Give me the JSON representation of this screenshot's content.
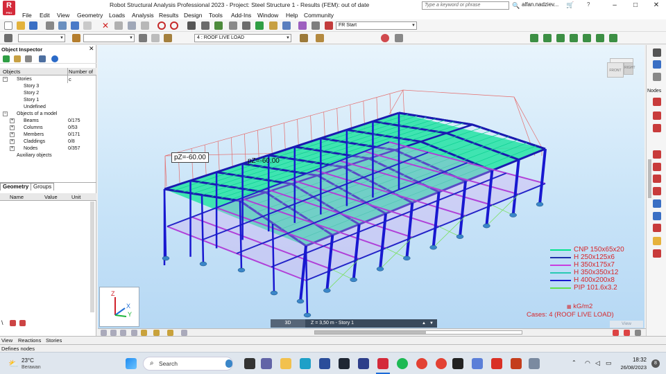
{
  "app": {
    "logo": "R",
    "logo_sub": "PRO",
    "title": "Robot Structural Analysis Professional 2023 - Project: Steel Structure 1 - Results (FEM): out of date",
    "search_placeholder": "Type a keyword or phrase",
    "user": "alfan.nadziev...",
    "window_buttons": [
      "–",
      "□",
      "✕"
    ]
  },
  "menu": [
    "File",
    "Edit",
    "View",
    "Geometry",
    "Loads",
    "Analysis",
    "Results",
    "Design",
    "Tools",
    "Add-Ins",
    "Window",
    "Help",
    "Community"
  ],
  "toolbar": {
    "layout_combo": "Start",
    "layout_combo_prefix": "FR",
    "load_case": "4 : ROOF LIVE LOAD"
  },
  "inspector": {
    "title": "Object Inspector",
    "columns": [
      "Objects",
      "Number of c"
    ],
    "tree": [
      {
        "label": "Stories",
        "count": "",
        "indent": 1,
        "expander": "−"
      },
      {
        "label": "Story 3",
        "count": "",
        "indent": 2,
        "expander": ""
      },
      {
        "label": "Story 2",
        "count": "",
        "indent": 2,
        "expander": ""
      },
      {
        "label": "Story 1",
        "count": "",
        "indent": 2,
        "expander": ""
      },
      {
        "label": "Undefined",
        "count": "",
        "indent": 2,
        "expander": ""
      },
      {
        "label": "Objects of a model",
        "count": "",
        "indent": 1,
        "expander": "−"
      },
      {
        "label": "Beams",
        "count": "0/175",
        "indent": 2,
        "expander": "+"
      },
      {
        "label": "Columns",
        "count": "0/53",
        "indent": 2,
        "expander": "+"
      },
      {
        "label": "Members",
        "count": "0/171",
        "indent": 2,
        "expander": "+"
      },
      {
        "label": "Claddings",
        "count": "0/8",
        "indent": 2,
        "expander": "+"
      },
      {
        "label": "Nodes",
        "count": "0/357",
        "indent": 2,
        "expander": "+"
      },
      {
        "label": "Auxiliary objects",
        "count": "",
        "indent": 1,
        "expander": ""
      }
    ],
    "tabs": [
      "Geometry",
      "Groups"
    ],
    "grid_columns": [
      "Name",
      "Value",
      "Unit"
    ]
  },
  "viewport": {
    "load_labels": [
      "pZ=-60.00",
      "pZ=-60.00"
    ],
    "legend": [
      {
        "label": "CNP 150x65x20",
        "color": "#00e38c"
      },
      {
        "label": "H 250x125x6",
        "color": "#1f2fa8"
      },
      {
        "label": "H 350x175x7",
        "color": "#c83de0"
      },
      {
        "label": "H 350x350x12",
        "color": "#28c9b3"
      },
      {
        "label": "H 400x200x8",
        "color": "#1818d0"
      },
      {
        "label": "PIP 101.6x3.2",
        "color": "#5fe04a"
      }
    ],
    "unit_label": "kG/m2",
    "cases_label": "Cases: 4 (ROOF LIVE LOAD)",
    "view_cube": {
      "front": "FRONT",
      "right": "RIGHT"
    },
    "axes": {
      "z": "Z",
      "x": "X",
      "y": "Y"
    },
    "view_label": "View",
    "status_mode": "3D",
    "status_story": "Z = 3,50 m - Story 1"
  },
  "right_panel": {
    "label": "Nodes"
  },
  "bottom_tabs": [
    "View",
    "Reactions",
    "Stories"
  ],
  "status_bar": "Defines nodes",
  "taskbar": {
    "weather_temp": "23°C",
    "weather_place": "Berawan",
    "search": "Search",
    "time": "18:32",
    "date": "26/08/2023",
    "notif": "8"
  }
}
